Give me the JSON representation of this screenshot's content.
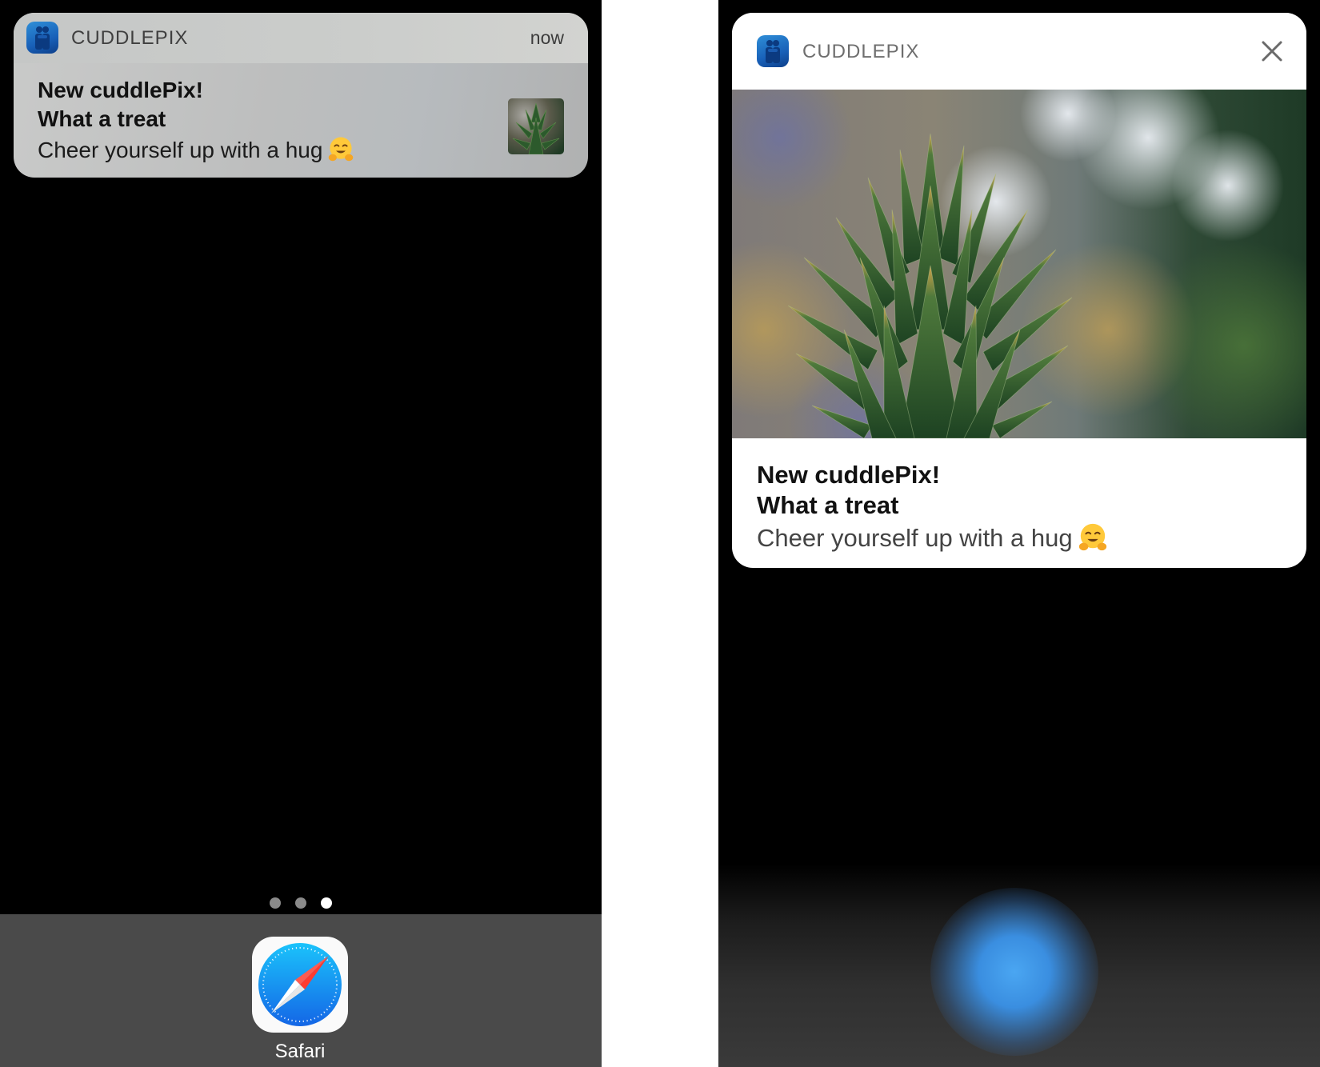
{
  "notification": {
    "app_name": "CUDDLEPIX",
    "time": "now",
    "title": "New cuddlePix!",
    "subtitle": "What a treat",
    "body": "Cheer yourself up with a hug"
  },
  "icons": {
    "app": "cuddlepix-app-icon",
    "emoji": "hugging-face-emoji",
    "close": "close-icon",
    "safari": "safari-compass-icon"
  },
  "home_screen": {
    "page_count": 3,
    "current_page": 3
  },
  "dock": {
    "apps": [
      {
        "label": "Safari"
      }
    ]
  },
  "colors": {
    "app_icon": "#1f6fc4",
    "banner": "#c3c4c3",
    "dock": "#4a4a4a",
    "safari_blue": "#1a8cf0",
    "safari_needle_red": "#ff3b30"
  }
}
